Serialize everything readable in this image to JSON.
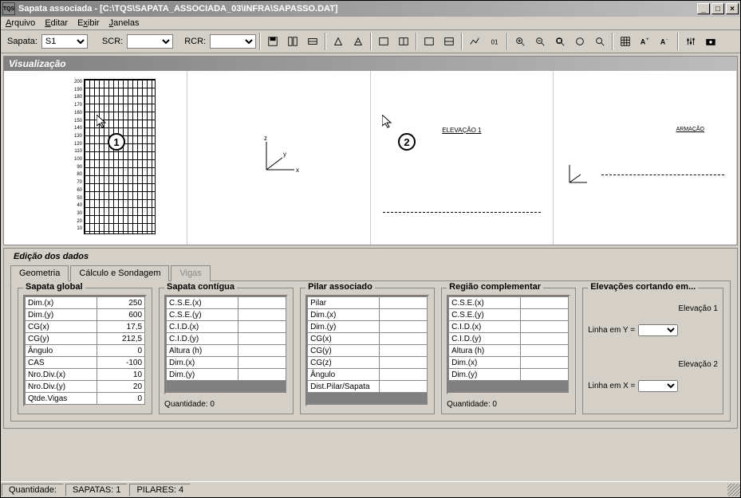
{
  "window": {
    "icon_text": "TQS",
    "title": "Sapata associada -  [C:\\TQS\\SAPATA_ASSOCIADA_03\\INFRA\\SAPASSO.DAT]"
  },
  "menubar": [
    "Arquivo",
    "Editar",
    "Exibir",
    "Janelas"
  ],
  "toolbar": {
    "sapata_label": "Sapata:",
    "sapata_value": "S1",
    "scr_label": "SCR:",
    "rcr_label": "RCR:"
  },
  "visualization": {
    "title": "Visualização",
    "ticks": "200\n190\n180\n170\n160\n150\n140\n130\n120\n110\n100\n90\n80\n70\n60\n50\n40\n30\n20\n10",
    "elev_label": "ELEVAÇÃO 1",
    "armacao_label": "ARMAÇÃO"
  },
  "callouts": {
    "c1": "1",
    "c2": "2"
  },
  "edit": {
    "title": "Edição dos dados",
    "tabs": {
      "geom": "Geometria",
      "calc": "Cálculo e Sondagem",
      "vigas": "Vigas"
    },
    "groups": {
      "g1": {
        "title": "Sapata global",
        "rows": [
          {
            "l": "Dim.(x)",
            "v": "250"
          },
          {
            "l": "Dim.(y)",
            "v": "600"
          },
          {
            "l": "CG(x)",
            "v": "17,5"
          },
          {
            "l": "CG(y)",
            "v": "212,5"
          },
          {
            "l": "Ângulo",
            "v": "0"
          },
          {
            "l": "CAS",
            "v": "-100"
          },
          {
            "l": "Nro.Div.(x)",
            "v": "10"
          },
          {
            "l": "Nro.Div.(y)",
            "v": "20"
          },
          {
            "l": "Qtde.Vigas",
            "v": "0"
          }
        ]
      },
      "g2": {
        "title": "Sapata contígua",
        "rows": [
          {
            "l": "C.S.E.(x)",
            "v": ""
          },
          {
            "l": "C.S.E.(y)",
            "v": ""
          },
          {
            "l": "C.I.D.(x)",
            "v": ""
          },
          {
            "l": "C.I.D.(y)",
            "v": ""
          },
          {
            "l": "Altura (h)",
            "v": ""
          },
          {
            "l": "Dim.(x)",
            "v": ""
          },
          {
            "l": "Dim.(y)",
            "v": ""
          }
        ],
        "qty": "Quantidade: 0"
      },
      "g3": {
        "title": "Pilar associado",
        "rows": [
          {
            "l": "Pilar",
            "v": ""
          },
          {
            "l": "Dim.(x)",
            "v": ""
          },
          {
            "l": "Dim.(y)",
            "v": ""
          },
          {
            "l": "CG(x)",
            "v": ""
          },
          {
            "l": "CG(y)",
            "v": ""
          },
          {
            "l": "CG(z)",
            "v": ""
          },
          {
            "l": "Ângulo",
            "v": ""
          },
          {
            "l": "Dist.Pilar/Sapata",
            "v": ""
          }
        ]
      },
      "g4": {
        "title": "Região complementar",
        "rows": [
          {
            "l": "C.S.E.(x)",
            "v": ""
          },
          {
            "l": "C.S.E.(y)",
            "v": ""
          },
          {
            "l": "C.I.D.(x)",
            "v": ""
          },
          {
            "l": "C.I.D.(y)",
            "v": ""
          },
          {
            "l": "Altura (h)",
            "v": ""
          },
          {
            "l": "Dim.(x)",
            "v": ""
          },
          {
            "l": "Dim.(y)",
            "v": ""
          }
        ],
        "qty": "Quantidade: 0"
      },
      "g5": {
        "title": "Elevações cortando em...",
        "elev1": "Elevação 1",
        "line_y": "Linha em Y =",
        "elev2": "Elevação 2",
        "line_x": "Linha em X ="
      }
    }
  },
  "statusbar": {
    "s1": "Quantidade:",
    "s2": "SAPATAS: 1",
    "s3": "PILARES: 4"
  }
}
